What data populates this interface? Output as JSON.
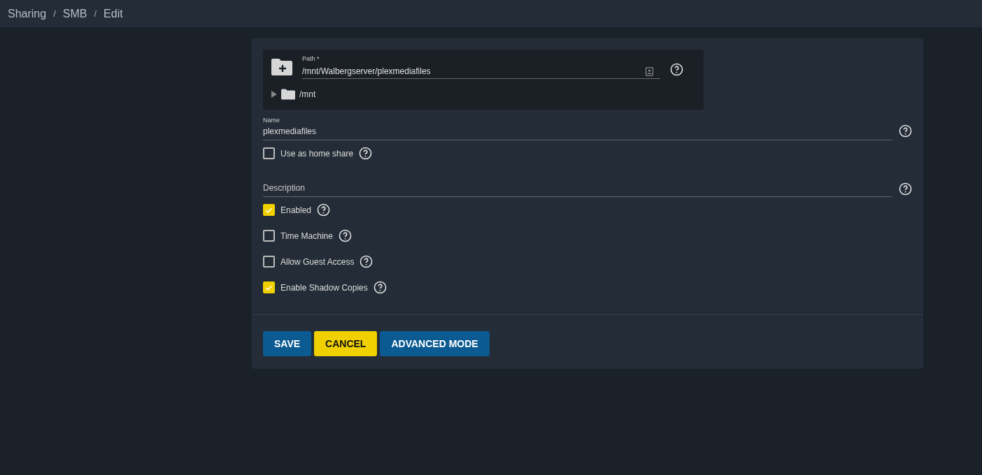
{
  "breadcrumb_separator": "/",
  "breadcrumb": [
    {
      "label": "Sharing"
    },
    {
      "label": "SMB"
    },
    {
      "label": "Edit"
    }
  ],
  "path_field": {
    "label": "Path *",
    "value": "/mnt/Walbergserver/plexmediafiles"
  },
  "tree": [
    {
      "label": "/mnt",
      "expanded": false
    }
  ],
  "name_field": {
    "label": "Name",
    "value": "plexmediafiles"
  },
  "home_share": {
    "label": "Use as home share",
    "checked": false
  },
  "description_field": {
    "placeholder": "Description"
  },
  "options": [
    {
      "label": "Enabled",
      "checked": true
    },
    {
      "label": "Time Machine",
      "checked": false
    },
    {
      "label": "Allow Guest Access",
      "checked": false
    },
    {
      "label": "Enable Shadow Copies",
      "checked": true
    }
  ],
  "buttons": [
    {
      "label": "SAVE",
      "kind": "primary"
    },
    {
      "label": "CANCEL",
      "kind": "accent"
    },
    {
      "label": "ADVANCED MODE",
      "kind": "primary"
    }
  ]
}
